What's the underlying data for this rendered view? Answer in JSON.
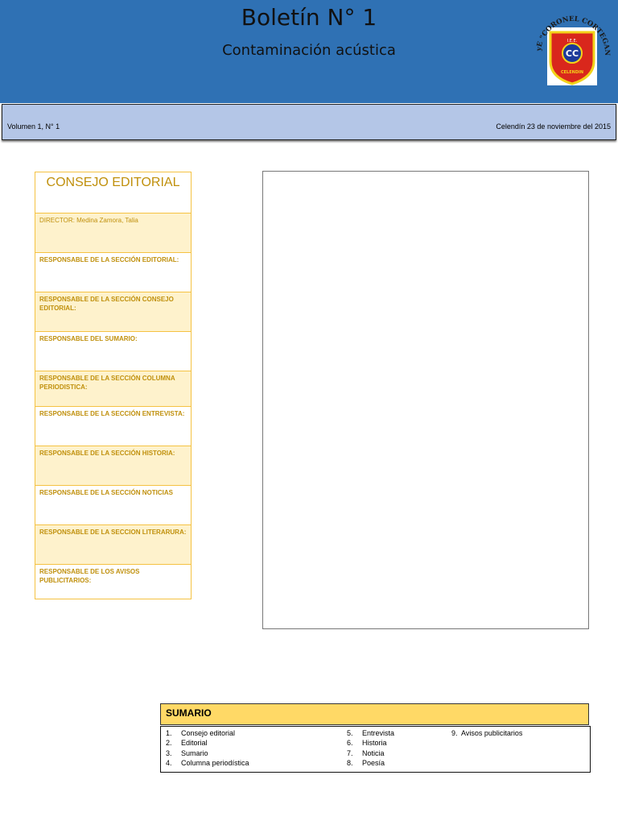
{
  "header": {
    "title": "Boletín N° 1",
    "subtitle": "Contaminación acústica",
    "logo": {
      "arc_text": "IEPyE \"CORONEL CORTEGANA\"",
      "badge_text": "CC",
      "top_text": "I.E.E.",
      "bottom_text": "CELENDIN",
      "colors": {
        "red": "#d9271c",
        "yellow": "#f3d31a",
        "blue": "#1d3a9a"
      }
    }
  },
  "infobar": {
    "volume": "Volumen 1, N° 1",
    "date": "Celendín 23 de noviembre del 2015"
  },
  "editorial": {
    "title": "CONSEJO EDITORIAL",
    "rows": [
      "DIRECTOR:  Medina Zamora, Talia",
      "RESPONSABLE DE LA SECCIÓN EDITORIAL:",
      "RESPONSABLE DE LA SECCIÓN CONSEJO EDITORIAL:",
      "RESPONSABLE DEL SUMARIO:",
      "RESPONSABLE DE LA SECCIÓN COLUMNA PERIODISTICA:",
      "RESPONSABLE DE LA SECCIÓN ENTREVISTA:",
      "RESPONSABLE DE LA SECCIÓN HISTORIA:",
      "RESPONSABLE DE LA SECCIÓN NOTICIAS",
      "RESPONSABLE DE LA SECCION LITERARURA:",
      "RESPONSABLE DE LOS AVISOS PUBLICITARIOS:"
    ]
  },
  "sumario": {
    "title": "SUMARIO",
    "items": [
      {
        "n": "1.",
        "label": "Consejo editorial"
      },
      {
        "n": "2.",
        "label": "Editorial"
      },
      {
        "n": "3.",
        "label": "Sumario"
      },
      {
        "n": "4.",
        "label": "Columna periodística"
      },
      {
        "n": "5.",
        "label": "Entrevista"
      },
      {
        "n": "6.",
        "label": "Historia"
      },
      {
        "n": "7.",
        "label": "Noticia"
      },
      {
        "n": "8.",
        "label": "Poesía"
      },
      {
        "n": "9.",
        "label": "Avisos publicitarios"
      }
    ]
  },
  "colors": {
    "header_blue": "#2f71b4",
    "infobar_blue": "#b4c6e7",
    "editorial_gold": "#c0900c",
    "editorial_border": "#f5c242",
    "editorial_shade": "#fef2cc",
    "sumario_yellow": "#ffd966"
  }
}
